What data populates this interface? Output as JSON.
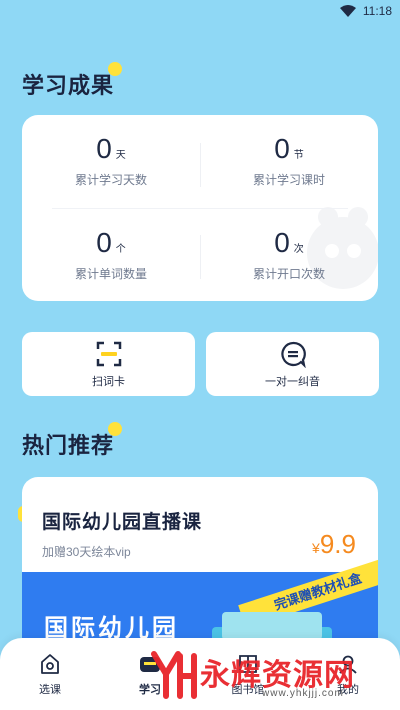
{
  "status": {
    "time": "11:18"
  },
  "results": {
    "title": "学习成果",
    "stats": [
      {
        "value": "0",
        "unit": "天",
        "label": "累计学习天数"
      },
      {
        "value": "0",
        "unit": "节",
        "label": "累计学习课时"
      },
      {
        "value": "0",
        "unit": "个",
        "label": "累计单词数量"
      },
      {
        "value": "0",
        "unit": "次",
        "label": "累计开口次数"
      }
    ]
  },
  "tools": [
    {
      "label": "扫词卡",
      "icon": "scan-icon"
    },
    {
      "label": "一对一纠音",
      "icon": "chat-icon"
    }
  ],
  "hot": {
    "title": "热门推荐",
    "course": {
      "title": "国际幼儿园直播课",
      "subtitle": "加赠30天绘本vip",
      "currency": "¥",
      "price": "9.9",
      "banner_title": "国际幼儿园",
      "ribbon": "完课赠教材礼盒"
    }
  },
  "nav": [
    {
      "label": "选课",
      "icon": "home-icon"
    },
    {
      "label": "学习",
      "icon": "study-icon"
    },
    {
      "label": "图书馆",
      "icon": "book-icon"
    },
    {
      "label": "我的",
      "icon": "profile-icon"
    }
  ],
  "watermark": {
    "text": "永辉资源网",
    "url": "www.yhkjjj.com"
  },
  "colors": {
    "background": "#8fd8f5",
    "accent_yellow": "#ffe23a",
    "price_orange": "#f58a1f",
    "banner_blue": "#2f7cf0"
  }
}
